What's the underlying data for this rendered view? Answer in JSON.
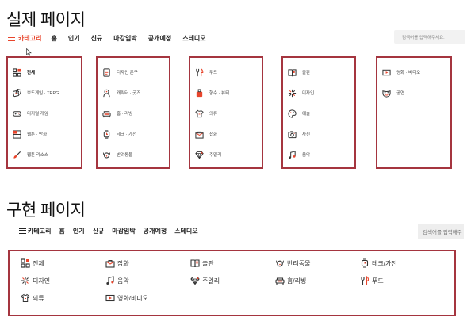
{
  "actual": {
    "title": "실제 페이지",
    "nav": {
      "category": "카테고리",
      "items": [
        "홈",
        "인기",
        "신규",
        "마감임박",
        "공개예정",
        "스테디오"
      ]
    },
    "search_placeholder": "검색어를 입력해주세요.",
    "columns": [
      [
        {
          "label": "전체",
          "icon": "grid-icon",
          "active": true
        },
        {
          "label": "보드게임 · TRPG",
          "icon": "dice-icon"
        },
        {
          "label": "디지털 게임",
          "icon": "gamepad-icon"
        },
        {
          "label": "웹툰 · 만화",
          "icon": "comic-icon"
        },
        {
          "label": "웹툰 리소스",
          "icon": "brush-icon"
        }
      ],
      [
        {
          "label": "디자인 문구",
          "icon": "notebook-icon"
        },
        {
          "label": "캐릭터 · 굿즈",
          "icon": "character-icon"
        },
        {
          "label": "홈 · 리빙",
          "icon": "sofa-icon"
        },
        {
          "label": "테크 · 가전",
          "icon": "watch-icon"
        },
        {
          "label": "반려동물",
          "icon": "dog-icon"
        }
      ],
      [
        {
          "label": "푸드",
          "icon": "utensils-icon"
        },
        {
          "label": "향수 · 뷰티",
          "icon": "perfume-icon"
        },
        {
          "label": "의류",
          "icon": "shirt-icon"
        },
        {
          "label": "잡화",
          "icon": "bag-icon"
        },
        {
          "label": "주얼리",
          "icon": "diamond-icon"
        }
      ],
      [
        {
          "label": "출판",
          "icon": "book-icon"
        },
        {
          "label": "디자인",
          "icon": "sparkle-icon"
        },
        {
          "label": "예술",
          "icon": "palette-icon"
        },
        {
          "label": "사진",
          "icon": "camera-icon"
        },
        {
          "label": "음악",
          "icon": "music-icon"
        }
      ],
      [
        {
          "label": "영화 · 비디오",
          "icon": "video-icon"
        },
        {
          "label": "공연",
          "icon": "mask-icon"
        }
      ]
    ]
  },
  "implemented": {
    "title": "구현 페이지",
    "nav": {
      "category": "카테고리",
      "items": [
        "홈",
        "인기",
        "신규",
        "마감임박",
        "공개예정",
        "스테디오"
      ]
    },
    "search_placeholder": "검색어를 입력해주",
    "items": [
      {
        "label": "전체",
        "icon": "grid-icon"
      },
      {
        "label": "잡화",
        "icon": "bag-icon"
      },
      {
        "label": "출판",
        "icon": "book-icon"
      },
      {
        "label": "반려동물",
        "icon": "dog-icon"
      },
      {
        "label": "테크/가전",
        "icon": "watch-icon"
      },
      {
        "label": "디자인",
        "icon": "sparkle-icon"
      },
      {
        "label": "음악",
        "icon": "music-icon"
      },
      {
        "label": "주얼리",
        "icon": "diamond-icon"
      },
      {
        "label": "홈/리빙",
        "icon": "sofa-icon"
      },
      {
        "label": "푸드",
        "icon": "utensils-icon"
      },
      {
        "label": "의류",
        "icon": "shirt-icon"
      },
      {
        "label": "영화/비디오",
        "icon": "video-icon"
      }
    ]
  },
  "colors": {
    "accent": "#e8452c",
    "frame": "#a5353f"
  }
}
